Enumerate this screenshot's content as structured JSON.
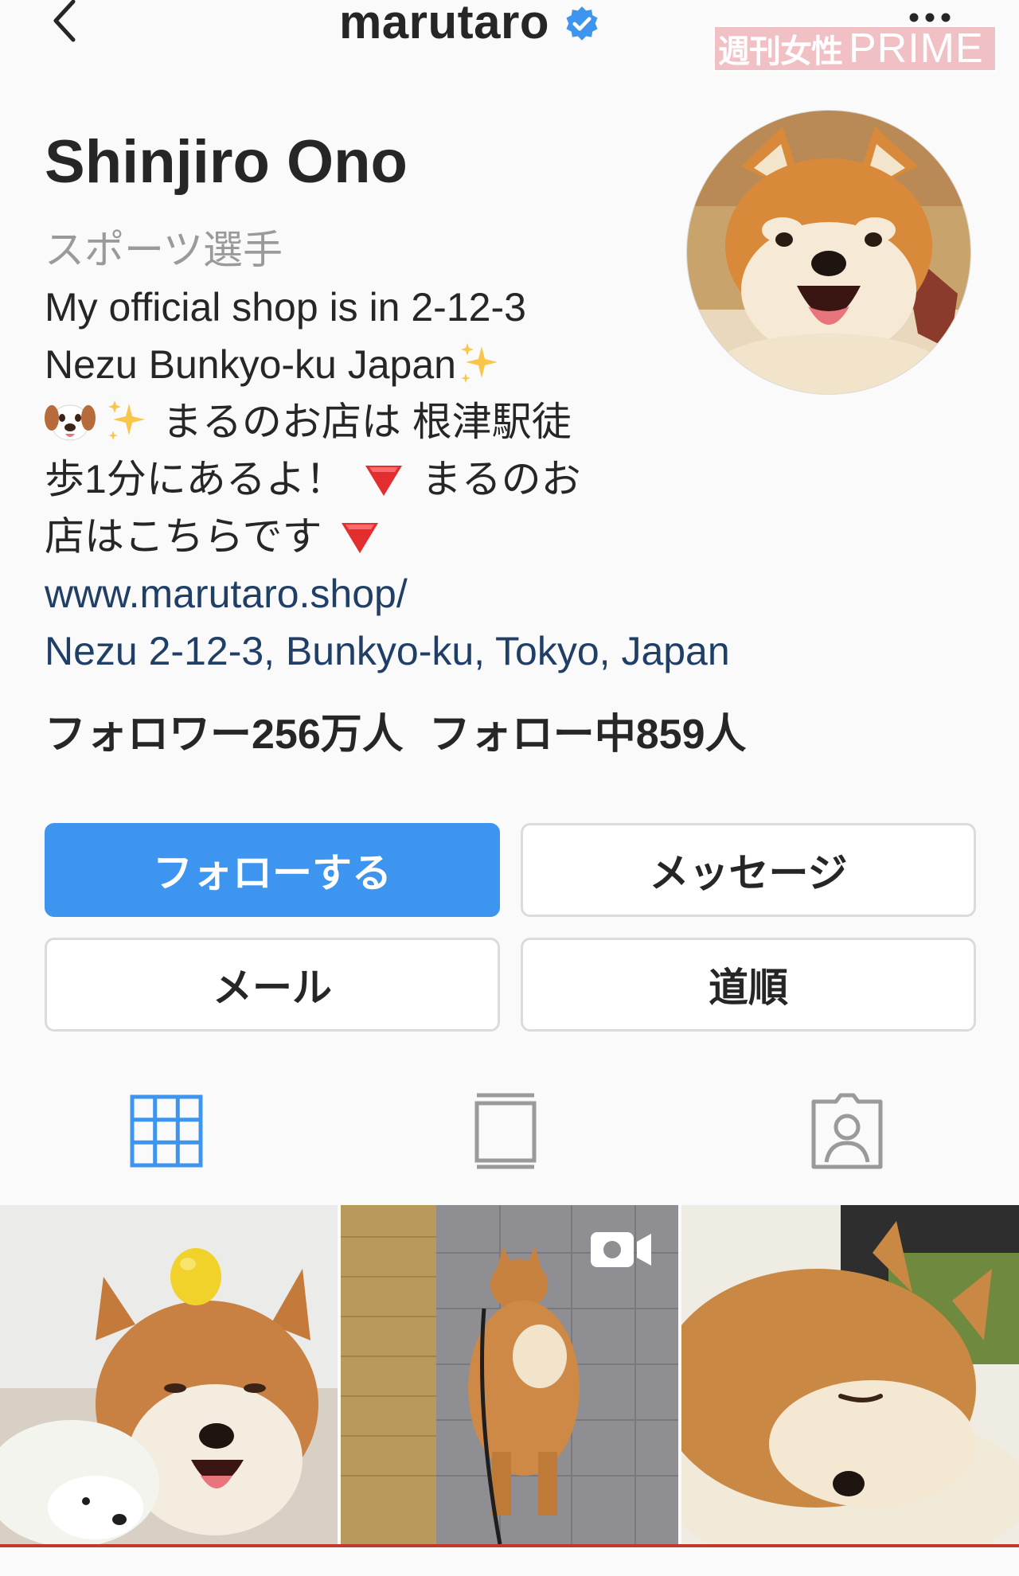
{
  "header": {
    "username": "marutaro",
    "watermark": {
      "jp": "週刊女性",
      "en": "PRIME"
    }
  },
  "profile": {
    "display_name": "Shinjiro Ono",
    "category": "スポーツ選手",
    "bio": {
      "line1": "My official shop is in 2-12-3",
      "line2": "Nezu Bunkyo-ku Japan",
      "line3": "まるのお店は 根津駅徒",
      "line4a": "歩1分にあるよ！",
      "line4b": "まるのお",
      "line5": "店はこちらです"
    },
    "website": "www.marutaro.shop/",
    "address": "Nezu 2-12-3, Bunkyo-ku, Tokyo, Japan",
    "followers": "フォロワー256万人",
    "following": "フォロー中859人"
  },
  "buttons": {
    "follow": "フォローする",
    "message": "メッセージ",
    "email": "メール",
    "directions": "道順"
  },
  "tabs": [
    {
      "icon": "grid-icon",
      "active": true
    },
    {
      "icon": "feed-icon",
      "active": false
    },
    {
      "icon": "tagged-icon",
      "active": false
    }
  ],
  "colors": {
    "accent": "#3d95ef",
    "link": "#1f3f67",
    "verified": "#3d95ef",
    "text": "#262626",
    "muted": "#9a9a9a",
    "border": "#dbdbdb",
    "watermark": "#f1c0c5"
  }
}
